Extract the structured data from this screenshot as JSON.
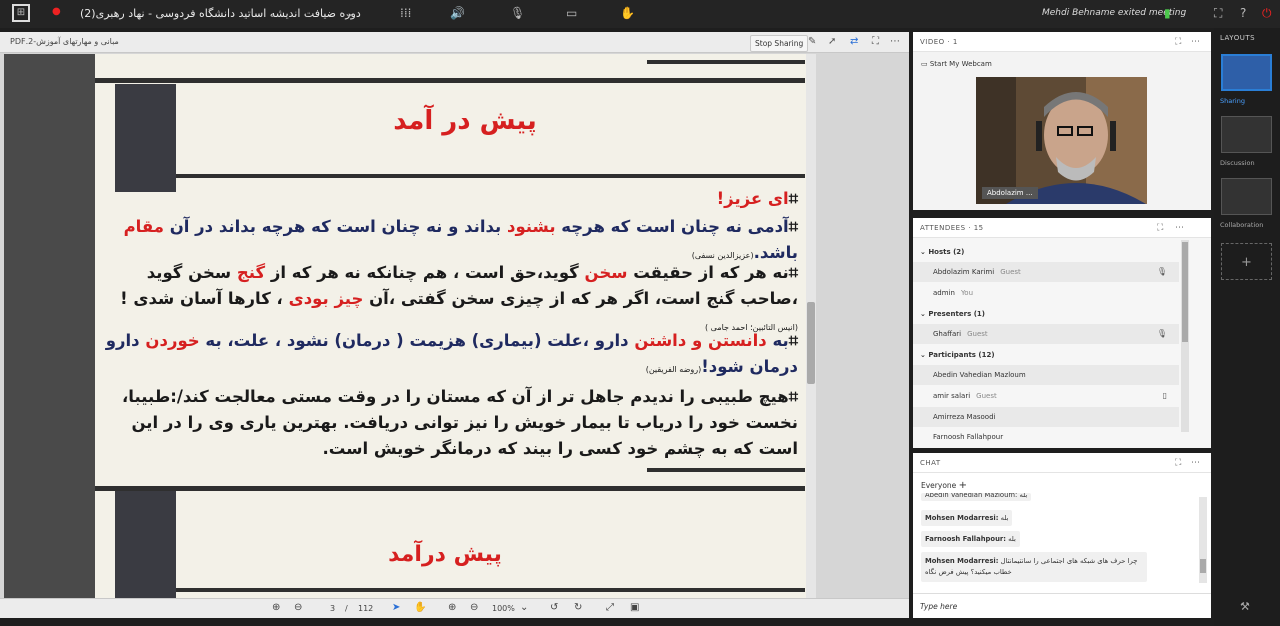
{
  "topbar": {
    "room_title": "دوره ضیافت اندیشه اساتید دانشگاه فردوسی - نهاد رهبری(2)",
    "notification": "Mehdi Behname exited meeting"
  },
  "share": {
    "pdf_name": "مبانی و مهارتهای آموزش-2.PDF",
    "stop_sharing_label": "Stop Sharing",
    "page_current": "3",
    "page_separator": "/",
    "page_total": "112",
    "zoom": "100%"
  },
  "slide": {
    "title1": "پیش در آمد",
    "title2": "پیش درآمد",
    "p1": "ای عزیز!",
    "p2a": "آدمی نه چنان است که هرچه ",
    "p2_red1": "بشنود",
    "p2b": " بداند و نه چنان است که هرچه بداند در آن ",
    "p2_red2": "مقام",
    "p2c": " باشد.",
    "p2_src": "(عزیزالدین نسفی)",
    "p3a": "نه هر که از حقیقت ",
    "p3_red1": "سخن",
    "p3b": " گوید،حق است ، هم چنانکه نه هر که از ",
    "p3_red2": "گنج",
    "p3c": " سخن گوید ،صاحب گنج است، اگر هر که از چیزی سخن گفتی ،آن ",
    "p3_red3": "چیز بودی",
    "p3d": " ، کارها آسان شدی !",
    "p3_src": "(انیس التائبین؛ احمد جامی )",
    "p4a": "به ",
    "p4_red1": "دانستن و داشتن",
    "p4b": " دارو ،علت (بیماری) هزیمت ( درمان) نشود ، علت، به ",
    "p4_red2": "خوردن",
    "p4c": " دارو درمان شود!",
    "p4_src": "(روضه الفریقین)",
    "p5": "هیچ طبیبی را ندیدم جاهل تر از آن که  مستان را در وقت مستی معالجت کند/:طبیبا، نخست خود را دریاب تا بیمار خویش را نیز توانی دریافت. بهترین یاری وی را در این است که به چشم خود کسی را بیند که درمانگر خویش است."
  },
  "video": {
    "title": "VIDEO · 1",
    "start_webcam": "Start My Webcam",
    "webcam_name": "Abdolazim ..."
  },
  "attendees": {
    "title": "ATTENDEES · 15",
    "hosts": "Hosts (2)",
    "host1_name": "Abdolazim Karimi",
    "host1_role": "Guest",
    "host2_name": "admin",
    "host2_role": "You",
    "presenters": "Presenters (1)",
    "pres1_name": "Ghaffari",
    "pres1_role": "Guest",
    "participants": "Participants (12)",
    "part1": "Abedin Vahedian Mazloum",
    "part2_name": "amir salari",
    "part2_role": "Guest",
    "part3": "Amirreza Masoodi",
    "part4": "Farnoosh Fallahpour"
  },
  "chat": {
    "title": "CHAT",
    "tab": "Everyone",
    "msg0": "Abedin Vahedian Mazloum: بله",
    "msg1_name": "Mohsen Modarresi:",
    "msg1_text": "بله",
    "msg2_name": "Farnoosh Fallahpour:",
    "msg2_text": "بله",
    "msg3_name": "Mohsen Modarresi:",
    "msg3_text": "چرا حرف های شبکه های اجتماعی را سانتیمانتال خطاب میکنید؟ پیش فرض نگاه",
    "input_placeholder": "Type here"
  },
  "layouts": {
    "title": "LAYOUTS",
    "l1": "Sharing",
    "l2": "Discussion",
    "l3": "Collaboration"
  }
}
